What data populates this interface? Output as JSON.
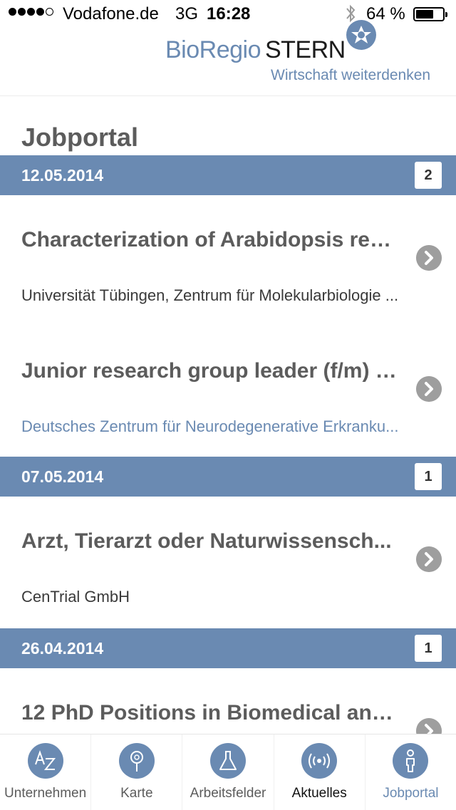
{
  "status_bar": {
    "carrier": "Vodafone.de",
    "network": "3G",
    "time": "16:28",
    "battery": "64 %",
    "battery_level": 0.64,
    "signal_bars": 4,
    "icons": [
      "signal-dots-icon",
      "bluetooth-icon",
      "battery-icon"
    ]
  },
  "header": {
    "brand_part1": "BioRegio",
    "brand_part2": "STERN",
    "tagline": "Wirtschaft weiterdenken",
    "logo_icon": "star-logo-icon",
    "brand_color": "#6a8ab2"
  },
  "page": {
    "title": "Jobportal"
  },
  "groups": [
    {
      "date": "12.05.2014",
      "count": "2",
      "jobs": [
        {
          "title": "Characterization of Arabidopsis rec...",
          "org": "Universität Tübingen, Zentrum für Molekularbiologie ..."
        },
        {
          "title": "Junior research group leader (f/m) i...",
          "org": "Deutsches Zentrum für Neurodegenerative Erkranku..."
        }
      ]
    },
    {
      "date": "07.05.2014",
      "count": "1",
      "jobs": [
        {
          "title": "Arzt, Tierarzt oder Naturwissensch...",
          "org": "CenTrial GmbH"
        }
      ]
    },
    {
      "date": "26.04.2014",
      "count": "1",
      "jobs": [
        {
          "title": "12 PhD Positions in Biomedical and...",
          "org": ""
        }
      ]
    }
  ],
  "tabs": [
    {
      "label": "Unternehmen",
      "icon": "az-icon"
    },
    {
      "label": "Karte",
      "icon": "map-pin-icon"
    },
    {
      "label": "Arbeitsfelder",
      "icon": "flask-icon"
    },
    {
      "label": "Aktuelles",
      "icon": "broadcast-icon"
    },
    {
      "label": "Jobportal",
      "icon": "person-icon",
      "active": true
    }
  ],
  "colors": {
    "accent": "#6a8ab2",
    "chevron": "#9e9e9e",
    "text": "#5c5c5c"
  }
}
